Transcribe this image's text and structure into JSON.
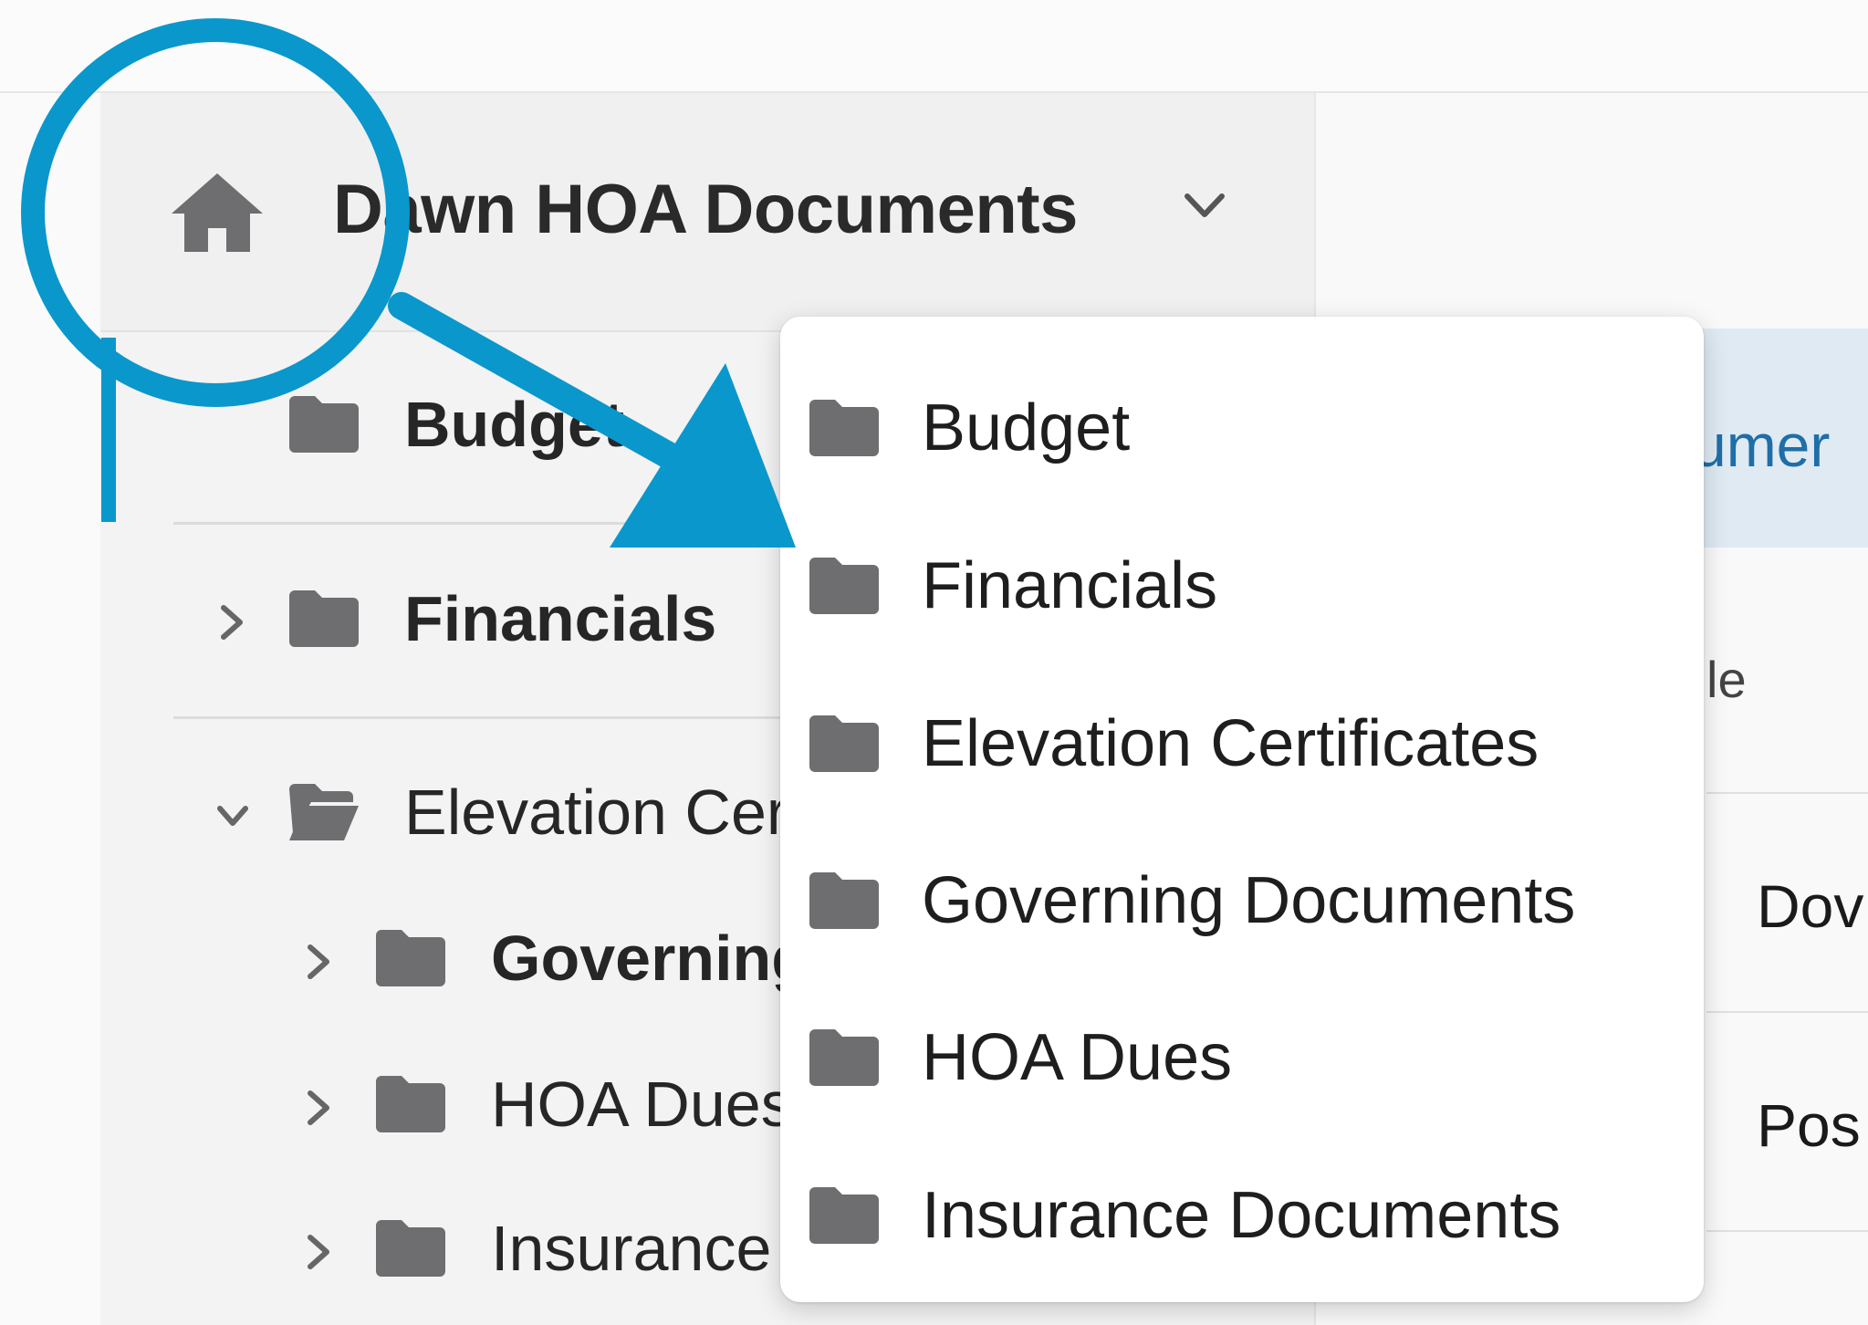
{
  "header": {
    "title": "Dawn HOA Documents"
  },
  "tree": {
    "items": [
      {
        "label": "Budget",
        "expanded": null,
        "bold": true,
        "open": false
      },
      {
        "label": "Financials",
        "expanded": false,
        "bold": true,
        "open": false
      },
      {
        "label": "Elevation Certificates",
        "expanded": true,
        "bold": false,
        "open": true
      },
      {
        "label": "Governing Documents",
        "expanded": false,
        "bold": true,
        "open": false
      },
      {
        "label": "HOA Dues",
        "expanded": false,
        "bold": false,
        "open": false
      },
      {
        "label": "Insurance Documents",
        "expanded": false,
        "bold": false,
        "open": false
      }
    ]
  },
  "dropdown": {
    "items": [
      {
        "label": "Budget"
      },
      {
        "label": "Financials"
      },
      {
        "label": "Elevation Certificates"
      },
      {
        "label": "Governing Documents"
      },
      {
        "label": "HOA Dues"
      },
      {
        "label": "Insurance Documents"
      }
    ]
  },
  "right_panel": {
    "tab_fragment": "umer",
    "column_fragment": "le",
    "row1_fragment": "Dov",
    "row2_fragment": "Pos"
  },
  "colors": {
    "accent": "#0a97cc",
    "folder": "#6e6e70",
    "link": "#1f6ea7"
  }
}
